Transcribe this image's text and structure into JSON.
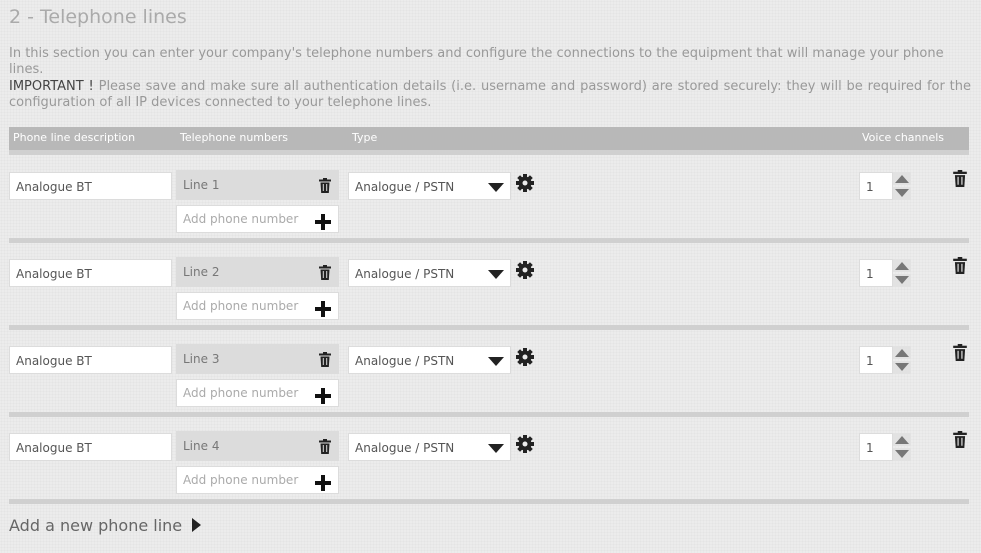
{
  "section": {
    "title": "2 - Telephone lines",
    "intro": "In this section you can enter your company's telephone numbers and configure the connections to the equipment that will manage your phone lines.",
    "important_label": "IMPORTANT !",
    "important_text": " Please save and make sure all authentication details (i.e. username and password) are stored securely: they will be required for the configuration of all IP devices connected to your telephone lines."
  },
  "table": {
    "headers": {
      "description": "Phone line description",
      "numbers": "Telephone numbers",
      "type": "Type",
      "channels": "Voice channels"
    },
    "rows": [
      {
        "description": "Analogue BT",
        "number": "Line 1",
        "add_placeholder": "Add phone number",
        "type": "Analogue / PSTN",
        "channels": "1"
      },
      {
        "description": "Analogue BT",
        "number": "Line 2",
        "add_placeholder": "Add phone number",
        "type": "Analogue / PSTN",
        "channels": "1"
      },
      {
        "description": "Analogue BT",
        "number": "Line 3",
        "add_placeholder": "Add phone number",
        "type": "Analogue / PSTN",
        "channels": "1"
      },
      {
        "description": "Analogue BT",
        "number": "Line 4",
        "add_placeholder": "Add phone number",
        "type": "Analogue / PSTN",
        "channels": "1"
      }
    ]
  },
  "add_line_label": "Add a new phone line",
  "icons": {
    "delete": "trash-icon",
    "add": "plus-icon",
    "settings": "gear-icon",
    "dropdown": "caret-down-icon",
    "spinner": "spinner-arrows-icon",
    "next": "triangle-right-icon"
  }
}
